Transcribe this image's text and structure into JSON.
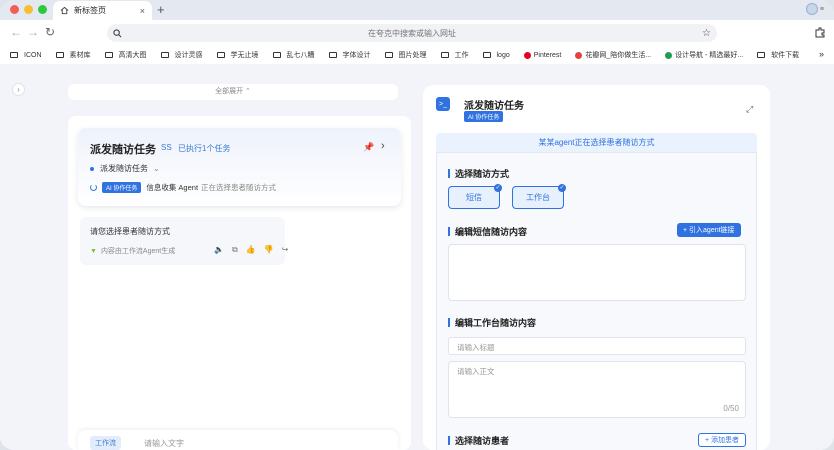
{
  "browser": {
    "tab_title": "新标签页",
    "tab_close": "×",
    "new_tab": "+",
    "avatar_label": "≡",
    "address_placeholder": "在夸克中搜索或输入网址",
    "bookmarks": [
      {
        "label": "ICON",
        "type": "folder"
      },
      {
        "label": "素材库",
        "type": "folder"
      },
      {
        "label": "高清大图",
        "type": "folder"
      },
      {
        "label": "设计灵感",
        "type": "folder"
      },
      {
        "label": "学无止境",
        "type": "folder"
      },
      {
        "label": "乱七八糟",
        "type": "folder"
      },
      {
        "label": "字体设计",
        "type": "folder"
      },
      {
        "label": "图片处理",
        "type": "folder"
      },
      {
        "label": "工作",
        "type": "folder"
      },
      {
        "label": "logo",
        "type": "folder"
      },
      {
        "label": "Pinterest",
        "type": "site",
        "color": "#e60023"
      },
      {
        "label": "花瓣网_陪你做生活...",
        "type": "site",
        "color": "#e6413a"
      },
      {
        "label": "设计导航 - 精选最好...",
        "type": "site",
        "color": "#1f9d55"
      },
      {
        "label": "软件下载",
        "type": "folder"
      }
    ]
  },
  "left": {
    "expand_all": "全部展开 ⌃",
    "task": {
      "title": "派发随访任务",
      "code": "SS",
      "executed": "已执行1个任务",
      "sub_task": "派发随访任务",
      "ai_badge": "AI 协作任务",
      "agent_name": "信息收集 Agent",
      "agent_status": "正在选择患者随访方式"
    },
    "reply": {
      "text": "请您选择患者随访方式",
      "meta": "内容由工作流Agent生成"
    },
    "input": {
      "tag": "工作流",
      "placeholder": "请输入文字"
    }
  },
  "right": {
    "title": "派发随访任务",
    "badge": "AI 协作任务",
    "status": "某某agent正在选择患者随访方式",
    "sections": {
      "method_title": "选择随访方式",
      "method_options": [
        "短信",
        "工作台"
      ],
      "sms_title": "编辑短信随访内容",
      "agent_link_button": "+ 引入agent链接",
      "workbench_title": "编辑工作台随访内容",
      "title_placeholder": "请输入标题",
      "body_placeholder": "请输入正文",
      "char_count": "0/50",
      "patient_title": "选择随访患者",
      "add_patient_button": "+ 添加患者"
    }
  },
  "colors": {
    "accent": "#2f72e0",
    "page_bg": "#f2f4f9"
  }
}
